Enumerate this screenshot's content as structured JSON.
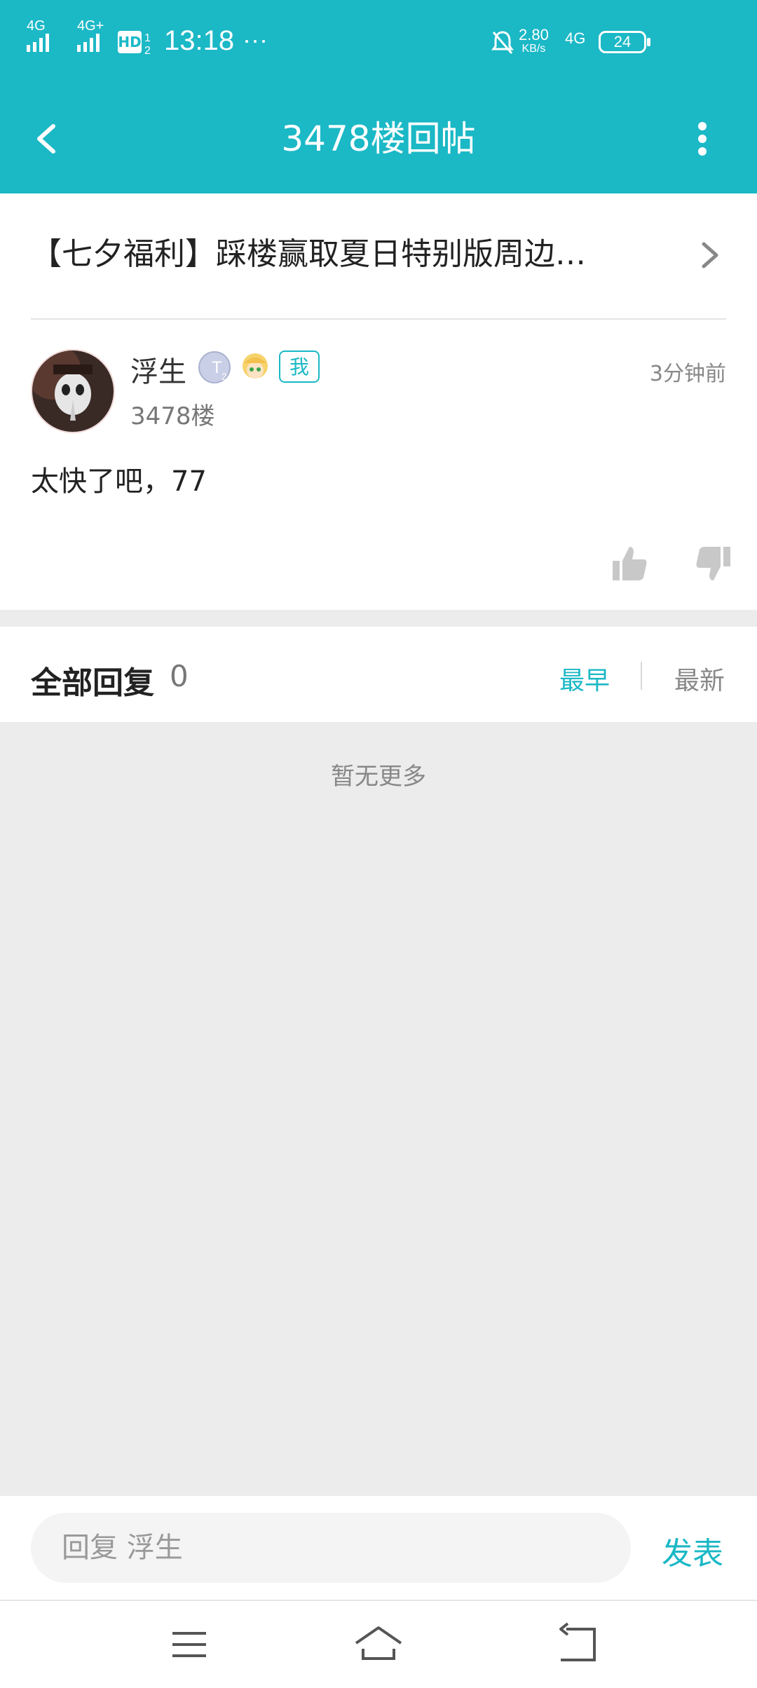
{
  "status_bar": {
    "net1": "4G",
    "net2": "4G+",
    "hd": "HD",
    "time": "13:18",
    "dots": "···",
    "speed_value": "2.80",
    "speed_unit": "KB/s",
    "net3": "4G",
    "battery": "24",
    "icons": [
      "signal-icon",
      "signal-icon",
      "hd-icon",
      "mute-bell-icon",
      "battery-icon"
    ]
  },
  "header": {
    "title": "3478楼回帖",
    "icons": [
      "back-arrow-icon",
      "more-vertical-icon"
    ]
  },
  "thread": {
    "title": "【七夕福利】踩楼赢取夏日特别版周边…",
    "icon": "chevron-right-icon"
  },
  "post": {
    "username": "浮生",
    "badge_t": "T",
    "badge_t_sub": "2",
    "badge_me": "我",
    "floor": "3478楼",
    "time": "3分钟前",
    "content": "太快了吧，77",
    "icons": [
      "thumbs-up-icon",
      "thumbs-down-icon"
    ]
  },
  "replies": {
    "label": "全部回复",
    "count": "0",
    "sort_earliest": "最早",
    "sort_newest": "最新",
    "empty_text": "暂无更多"
  },
  "reply_box": {
    "placeholder": "回复 浮生",
    "publish_label": "发表"
  },
  "navbar": {
    "icons": [
      "menu-icon",
      "home-icon",
      "return-icon"
    ]
  },
  "colors": {
    "accent": "#1bb8c6",
    "background": "#ececec"
  }
}
